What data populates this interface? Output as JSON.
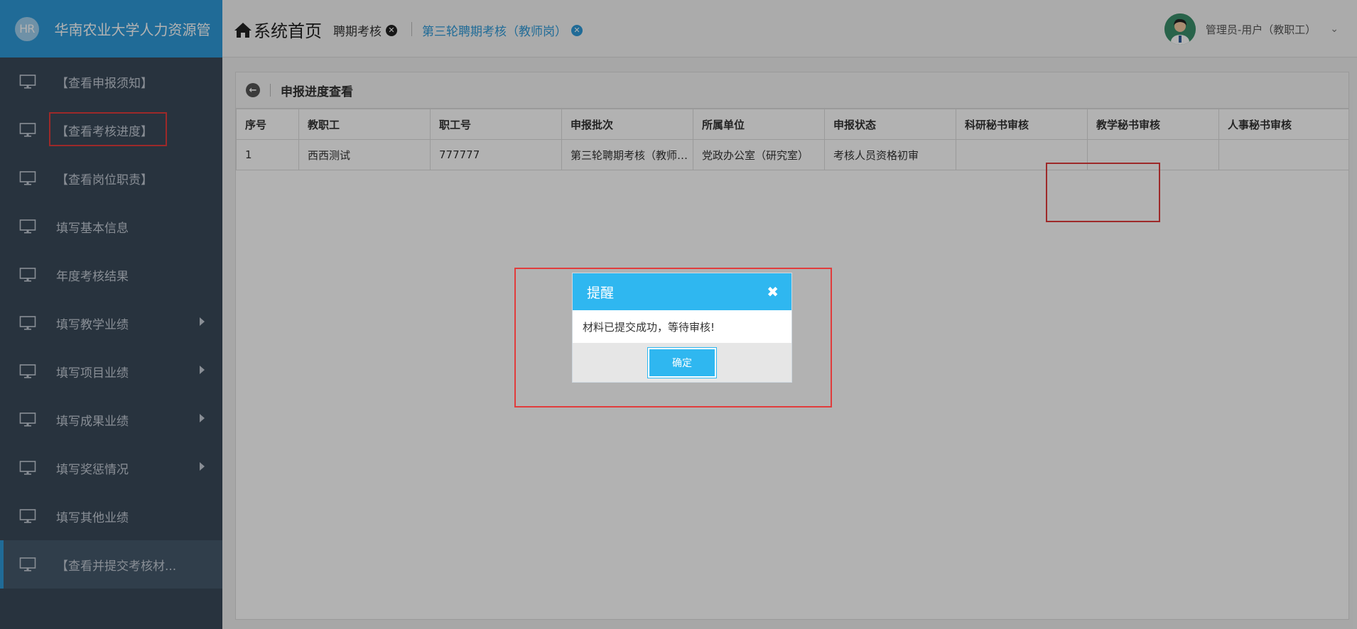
{
  "brand": {
    "logo_text": "HR",
    "title": "华南农业大学人力资源管"
  },
  "sidebar": {
    "items": [
      {
        "label": "【查看申报须知】",
        "has_submenu": false
      },
      {
        "label": "【查看考核进度】",
        "has_submenu": false
      },
      {
        "label": "【查看岗位职责】",
        "has_submenu": false
      },
      {
        "label": "填写基本信息",
        "has_submenu": false
      },
      {
        "label": "年度考核结果",
        "has_submenu": false
      },
      {
        "label": "填写教学业绩",
        "has_submenu": true
      },
      {
        "label": "填写项目业绩",
        "has_submenu": true
      },
      {
        "label": "填写成果业绩",
        "has_submenu": true
      },
      {
        "label": "填写奖惩情况",
        "has_submenu": true
      },
      {
        "label": "填写其他业绩",
        "has_submenu": false
      },
      {
        "label": "【查看并提交考核材...",
        "has_submenu": false,
        "active": true
      }
    ]
  },
  "header": {
    "home_label": "系统首页",
    "tabs": [
      {
        "label": "聘期考核"
      },
      {
        "label": "第三轮聘期考核（教师岗）"
      }
    ],
    "user": {
      "name": "管理员-用户（教职工）"
    }
  },
  "panel": {
    "title": "申报进度查看",
    "columns": [
      "序号",
      "教职工",
      "职工号",
      "申报批次",
      "所属单位",
      "申报状态",
      "科研秘书审核",
      "教学秘书审核",
      "人事秘书审核"
    ],
    "rows": [
      [
        "1",
        "西西测试",
        "777777",
        "第三轮聘期考核（教师岗）",
        "党政办公室（研究室）",
        "考核人员资格初审",
        "",
        "",
        ""
      ]
    ]
  },
  "dialog": {
    "title": "提醒",
    "message": "材料已提交成功，等待审核!",
    "ok_label": "确定"
  },
  "colors": {
    "accent": "#2e9ad8",
    "dialog_header": "#2fb7f0",
    "sidebar_bg": "#3a4a5a",
    "highlight_box": "#e13c3c"
  }
}
